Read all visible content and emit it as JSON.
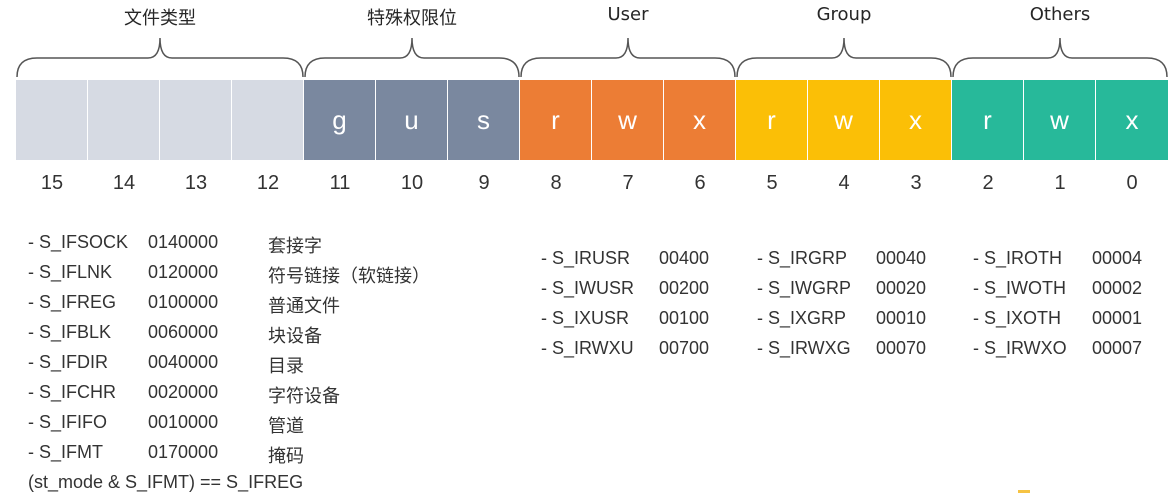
{
  "colors": {
    "type_cells": "#d6dae3",
    "special_cells": "#7a889f",
    "user_cells": "#ec7d35",
    "group_cells": "#fbbf06",
    "others_cells": "#27b99a",
    "brace": "#555555"
  },
  "groups": [
    {
      "label": "文件类型",
      "color_key": "type_cells"
    },
    {
      "label": "特殊权限位",
      "color_key": "special_cells"
    },
    {
      "label": "User",
      "color_key": "user_cells"
    },
    {
      "label": "Group",
      "color_key": "group_cells"
    },
    {
      "label": "Others",
      "color_key": "others_cells"
    }
  ],
  "cells": [
    {
      "letter": "",
      "index": "15",
      "group": 0
    },
    {
      "letter": "",
      "index": "14",
      "group": 0
    },
    {
      "letter": "",
      "index": "13",
      "group": 0
    },
    {
      "letter": "",
      "index": "12",
      "group": 0
    },
    {
      "letter": "g",
      "index": "11",
      "group": 1
    },
    {
      "letter": "u",
      "index": "10",
      "group": 1
    },
    {
      "letter": "s",
      "index": "9",
      "group": 1
    },
    {
      "letter": "r",
      "index": "8",
      "group": 2
    },
    {
      "letter": "w",
      "index": "7",
      "group": 2
    },
    {
      "letter": "x",
      "index": "6",
      "group": 2
    },
    {
      "letter": "r",
      "index": "5",
      "group": 3
    },
    {
      "letter": "w",
      "index": "4",
      "group": 3
    },
    {
      "letter": "x",
      "index": "3",
      "group": 3
    },
    {
      "letter": "r",
      "index": "2",
      "group": 4
    },
    {
      "letter": "w",
      "index": "1",
      "group": 4
    },
    {
      "letter": "x",
      "index": "0",
      "group": 4
    }
  ],
  "file_types": [
    {
      "name": "- S_IFSOCK",
      "value": "0140000",
      "desc": "套接字"
    },
    {
      "name": "- S_IFLNK",
      "value": "0120000",
      "desc": "符号链接（软链接）"
    },
    {
      "name": "- S_IFREG",
      "value": "0100000",
      "desc": "普通文件"
    },
    {
      "name": "- S_IFBLK",
      "value": "0060000",
      "desc": "块设备"
    },
    {
      "name": "- S_IFDIR",
      "value": "0040000",
      "desc": "目录"
    },
    {
      "name": "- S_IFCHR",
      "value": "0020000",
      "desc": "字符设备"
    },
    {
      "name": "- S_IFIFO",
      "value": "0010000",
      "desc": "管道"
    },
    {
      "name": "- S_IFMT",
      "value": "0170000",
      "desc": "掩码"
    }
  ],
  "user_perms": [
    {
      "name": "- S_IRUSR",
      "value": "00400"
    },
    {
      "name": "- S_IWUSR",
      "value": "00200"
    },
    {
      "name": "- S_IXUSR",
      "value": "00100"
    },
    {
      "name": "- S_IRWXU",
      "value": "00700"
    }
  ],
  "group_perms": [
    {
      "name": "- S_IRGRP",
      "value": "00040"
    },
    {
      "name": "- S_IWGRP",
      "value": "00020"
    },
    {
      "name": "- S_IXGRP",
      "value": "00010"
    },
    {
      "name": "- S_IRWXG",
      "value": "00070"
    }
  ],
  "other_perms": [
    {
      "name": "- S_IROTH",
      "value": "00004"
    },
    {
      "name": "- S_IWOTH",
      "value": "00002"
    },
    {
      "name": "- S_IXOTH",
      "value": "00001"
    },
    {
      "name": "- S_IRWXO",
      "value": "00007"
    }
  ],
  "expression": "(st_mode & S_IFMT) ==  S_IFREG"
}
